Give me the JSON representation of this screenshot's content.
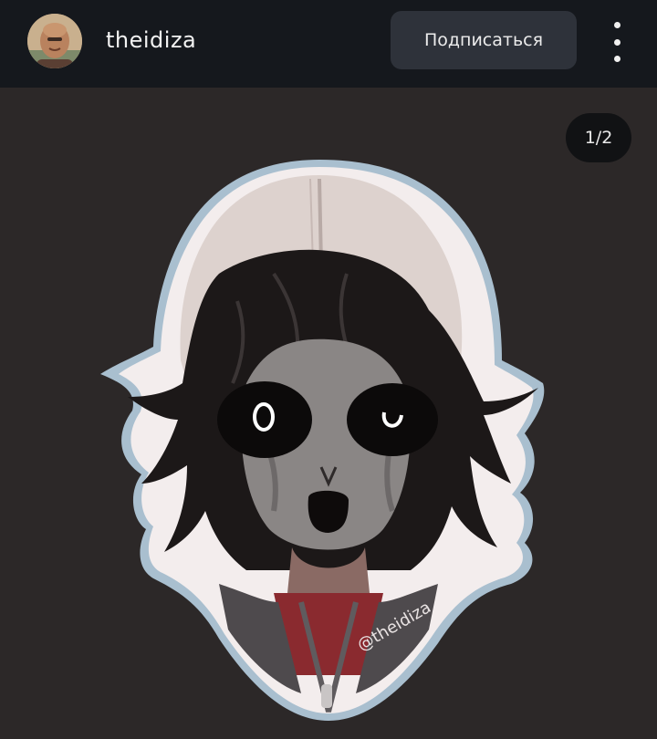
{
  "header": {
    "username": "theidiza",
    "subscribe_label": "Подписаться",
    "avatar_icon": "user-avatar-photo",
    "more_icon": "vertical-ellipsis-icon"
  },
  "post": {
    "page_counter": "1/2",
    "watermark": "@theidiza",
    "image_description": "sticker-style illustration of a character with a beige hood, dark hair and black hollow eyes"
  },
  "colors": {
    "topbar": "#15181d",
    "background": "#2b2727",
    "button": "#2e323a",
    "counter": "#111214"
  }
}
